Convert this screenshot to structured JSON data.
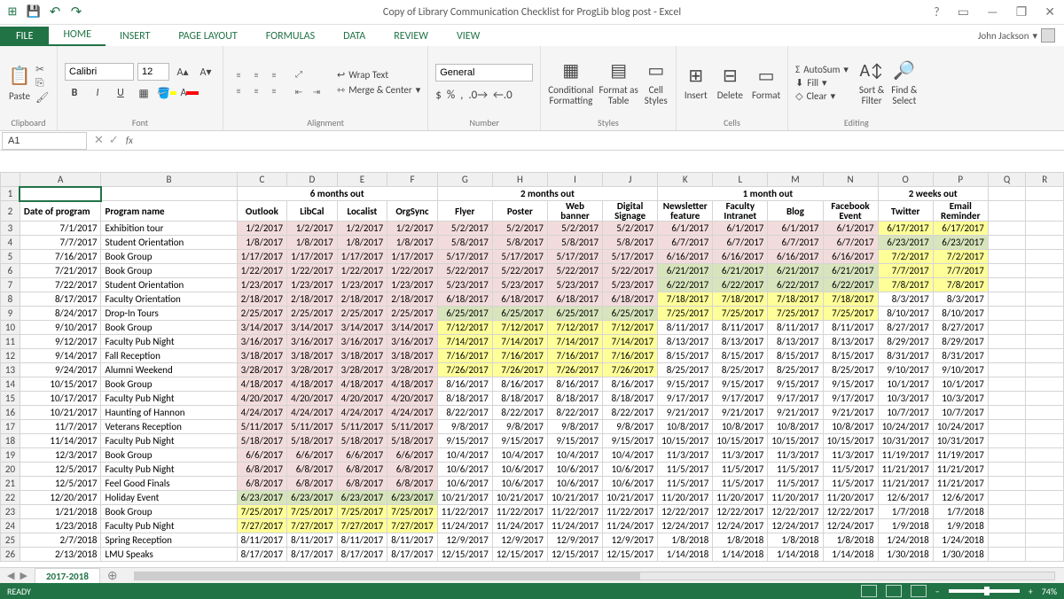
{
  "title": "Copy of Library Communication Checklist for ProgLib blog post - Excel",
  "user": "John Jackson",
  "tabs": {
    "file": "FILE",
    "items": [
      "HOME",
      "INSERT",
      "PAGE LAYOUT",
      "FORMULAS",
      "DATA",
      "REVIEW",
      "VIEW"
    ],
    "active": 0
  },
  "ribbon": {
    "clipboard_label": "Clipboard",
    "paste": "Paste",
    "font_label": "Font",
    "font_name": "Calibri",
    "font_size": "12",
    "alignment_label": "Alignment",
    "wrap": "Wrap Text",
    "merge": "Merge & Center",
    "number_label": "Number",
    "number_fmt": "General",
    "styles_label": "Styles",
    "cond": "Conditional\nFormatting",
    "fat": "Format as\nTable",
    "cell_styles": "Cell\nStyles",
    "cells_label": "Cells",
    "insert": "Insert",
    "delete": "Delete",
    "format": "Format",
    "editing_label": "Editing",
    "autosum": "AutoSum",
    "fill": "Fill",
    "clear": "Clear",
    "sort": "Sort &\nFilter",
    "find": "Find &\nSelect"
  },
  "name_box": "A1",
  "sheet_tab": "2017-2018",
  "status": "READY",
  "zoom": "74%",
  "cols": [
    "A",
    "B",
    "C",
    "D",
    "E",
    "F",
    "G",
    "H",
    "I",
    "J",
    "K",
    "L",
    "M",
    "N",
    "O",
    "P",
    "Q",
    "R"
  ],
  "group_headers": {
    "six_months": "6 months out",
    "two_months": "2 months out",
    "one_month": "1 month out",
    "two_weeks": "2 weeks out"
  },
  "col_headers": {
    "date": "Date of program",
    "name": "Program name",
    "outlook": "Outlook",
    "libcal": "LibCal",
    "localist": "Localist",
    "orgsync": "OrgSync",
    "flyer": "Flyer",
    "poster": "Poster",
    "web": "Web banner",
    "signage": "Digital Signage",
    "news": "Newsletter feature",
    "intranet": "Faculty Intranet",
    "blog": "Blog",
    "fb": "Facebook Event",
    "twitter": "Twitter",
    "email": "Email Reminder"
  },
  "rows": [
    {
      "r": 3,
      "date": "7/1/2017",
      "name": "Exhibition tour",
      "c": [
        "1/2/2017",
        "1/2/2017",
        "1/2/2017",
        "1/2/2017"
      ],
      "d": [
        "5/2/2017",
        "5/2/2017",
        "5/2/2017",
        "5/2/2017"
      ],
      "e": [
        "6/1/2017",
        "6/1/2017",
        "6/1/2017",
        "6/1/2017"
      ],
      "f": [
        "6/17/2017",
        "6/17/2017"
      ],
      "cls": {
        "c": "pink",
        "d": "pink",
        "e": "pink",
        "f": "yellow"
      }
    },
    {
      "r": 4,
      "date": "7/7/2017",
      "name": "Student Orientation",
      "c": [
        "1/8/2017",
        "1/8/2017",
        "1/8/2017",
        "1/8/2017"
      ],
      "d": [
        "5/8/2017",
        "5/8/2017",
        "5/8/2017",
        "5/8/2017"
      ],
      "e": [
        "6/7/2017",
        "6/7/2017",
        "6/7/2017",
        "6/7/2017"
      ],
      "f": [
        "6/23/2017",
        "6/23/2017"
      ],
      "cls": {
        "c": "pink",
        "d": "pink",
        "e": "pink",
        "f": "green"
      }
    },
    {
      "r": 5,
      "date": "7/16/2017",
      "name": "Book Group",
      "c": [
        "1/17/2017",
        "1/17/2017",
        "1/17/2017",
        "1/17/2017"
      ],
      "d": [
        "5/17/2017",
        "5/17/2017",
        "5/17/2017",
        "5/17/2017"
      ],
      "e": [
        "6/16/2017",
        "6/16/2017",
        "6/16/2017",
        "6/16/2017"
      ],
      "f": [
        "7/2/2017",
        "7/2/2017"
      ],
      "cls": {
        "c": "pink",
        "d": "pink",
        "e": "pink",
        "f": "yellow"
      }
    },
    {
      "r": 6,
      "date": "7/21/2017",
      "name": "Book Group",
      "c": [
        "1/22/2017",
        "1/22/2017",
        "1/22/2017",
        "1/22/2017"
      ],
      "d": [
        "5/22/2017",
        "5/22/2017",
        "5/22/2017",
        "5/22/2017"
      ],
      "e": [
        "6/21/2017",
        "6/21/2017",
        "6/21/2017",
        "6/21/2017"
      ],
      "f": [
        "7/7/2017",
        "7/7/2017"
      ],
      "cls": {
        "c": "pink",
        "d": "pink",
        "e": "green",
        "f": "yellow"
      }
    },
    {
      "r": 7,
      "date": "7/22/2017",
      "name": "Student Orientation",
      "c": [
        "1/23/2017",
        "1/23/2017",
        "1/23/2017",
        "1/23/2017"
      ],
      "d": [
        "5/23/2017",
        "5/23/2017",
        "5/23/2017",
        "5/23/2017"
      ],
      "e": [
        "6/22/2017",
        "6/22/2017",
        "6/22/2017",
        "6/22/2017"
      ],
      "f": [
        "7/8/2017",
        "7/8/2017"
      ],
      "cls": {
        "c": "pink",
        "d": "pink",
        "e": "green",
        "f": "yellow"
      }
    },
    {
      "r": 8,
      "date": "8/17/2017",
      "name": "Faculty Orientation",
      "c": [
        "2/18/2017",
        "2/18/2017",
        "2/18/2017",
        "2/18/2017"
      ],
      "d": [
        "6/18/2017",
        "6/18/2017",
        "6/18/2017",
        "6/18/2017"
      ],
      "e": [
        "7/18/2017",
        "7/18/2017",
        "7/18/2017",
        "7/18/2017"
      ],
      "f": [
        "8/3/2017",
        "8/3/2017"
      ],
      "cls": {
        "c": "pink",
        "d": "pink",
        "e": "yellow",
        "f": ""
      }
    },
    {
      "r": 9,
      "date": "8/24/2017",
      "name": "Drop-In Tours",
      "c": [
        "2/25/2017",
        "2/25/2017",
        "2/25/2017",
        "2/25/2017"
      ],
      "d": [
        "6/25/2017",
        "6/25/2017",
        "6/25/2017",
        "6/25/2017"
      ],
      "e": [
        "7/25/2017",
        "7/25/2017",
        "7/25/2017",
        "7/25/2017"
      ],
      "f": [
        "8/10/2017",
        "8/10/2017"
      ],
      "cls": {
        "c": "pink",
        "d": "green",
        "e": "yellow",
        "f": ""
      }
    },
    {
      "r": 10,
      "date": "9/10/2017",
      "name": "Book Group",
      "c": [
        "3/14/2017",
        "3/14/2017",
        "3/14/2017",
        "3/14/2017"
      ],
      "d": [
        "7/12/2017",
        "7/12/2017",
        "7/12/2017",
        "7/12/2017"
      ],
      "e": [
        "8/11/2017",
        "8/11/2017",
        "8/11/2017",
        "8/11/2017"
      ],
      "f": [
        "8/27/2017",
        "8/27/2017"
      ],
      "cls": {
        "c": "pink",
        "d": "yellow",
        "e": "",
        "f": ""
      }
    },
    {
      "r": 11,
      "date": "9/12/2017",
      "name": "Faculty Pub Night",
      "c": [
        "3/16/2017",
        "3/16/2017",
        "3/16/2017",
        "3/16/2017"
      ],
      "d": [
        "7/14/2017",
        "7/14/2017",
        "7/14/2017",
        "7/14/2017"
      ],
      "e": [
        "8/13/2017",
        "8/13/2017",
        "8/13/2017",
        "8/13/2017"
      ],
      "f": [
        "8/29/2017",
        "8/29/2017"
      ],
      "cls": {
        "c": "pink",
        "d": "yellow",
        "e": "",
        "f": ""
      }
    },
    {
      "r": 12,
      "date": "9/14/2017",
      "name": "Fall Reception",
      "c": [
        "3/18/2017",
        "3/18/2017",
        "3/18/2017",
        "3/18/2017"
      ],
      "d": [
        "7/16/2017",
        "7/16/2017",
        "7/16/2017",
        "7/16/2017"
      ],
      "e": [
        "8/15/2017",
        "8/15/2017",
        "8/15/2017",
        "8/15/2017"
      ],
      "f": [
        "8/31/2017",
        "8/31/2017"
      ],
      "cls": {
        "c": "pink",
        "d": "yellow",
        "e": "",
        "f": ""
      }
    },
    {
      "r": 13,
      "date": "9/24/2017",
      "name": "Alumni Weekend",
      "c": [
        "3/28/2017",
        "3/28/2017",
        "3/28/2017",
        "3/28/2017"
      ],
      "d": [
        "7/26/2017",
        "7/26/2017",
        "7/26/2017",
        "7/26/2017"
      ],
      "e": [
        "8/25/2017",
        "8/25/2017",
        "8/25/2017",
        "8/25/2017"
      ],
      "f": [
        "9/10/2017",
        "9/10/2017"
      ],
      "cls": {
        "c": "pink",
        "d": "yellow",
        "e": "",
        "f": ""
      }
    },
    {
      "r": 14,
      "date": "10/15/2017",
      "name": "Book Group",
      "c": [
        "4/18/2017",
        "4/18/2017",
        "4/18/2017",
        "4/18/2017"
      ],
      "d": [
        "8/16/2017",
        "8/16/2017",
        "8/16/2017",
        "8/16/2017"
      ],
      "e": [
        "9/15/2017",
        "9/15/2017",
        "9/15/2017",
        "9/15/2017"
      ],
      "f": [
        "10/1/2017",
        "10/1/2017"
      ],
      "cls": {
        "c": "pink",
        "d": "",
        "e": "",
        "f": ""
      }
    },
    {
      "r": 15,
      "date": "10/17/2017",
      "name": "Faculty Pub Night",
      "c": [
        "4/20/2017",
        "4/20/2017",
        "4/20/2017",
        "4/20/2017"
      ],
      "d": [
        "8/18/2017",
        "8/18/2017",
        "8/18/2017",
        "8/18/2017"
      ],
      "e": [
        "9/17/2017",
        "9/17/2017",
        "9/17/2017",
        "9/17/2017"
      ],
      "f": [
        "10/3/2017",
        "10/3/2017"
      ],
      "cls": {
        "c": "pink",
        "d": "",
        "e": "",
        "f": ""
      }
    },
    {
      "r": 16,
      "date": "10/21/2017",
      "name": "Haunting of Hannon",
      "c": [
        "4/24/2017",
        "4/24/2017",
        "4/24/2017",
        "4/24/2017"
      ],
      "d": [
        "8/22/2017",
        "8/22/2017",
        "8/22/2017",
        "8/22/2017"
      ],
      "e": [
        "9/21/2017",
        "9/21/2017",
        "9/21/2017",
        "9/21/2017"
      ],
      "f": [
        "10/7/2017",
        "10/7/2017"
      ],
      "cls": {
        "c": "pink",
        "d": "",
        "e": "",
        "f": ""
      }
    },
    {
      "r": 17,
      "date": "11/7/2017",
      "name": "Veterans Reception",
      "c": [
        "5/11/2017",
        "5/11/2017",
        "5/11/2017",
        "5/11/2017"
      ],
      "d": [
        "9/8/2017",
        "9/8/2017",
        "9/8/2017",
        "9/8/2017"
      ],
      "e": [
        "10/8/2017",
        "10/8/2017",
        "10/8/2017",
        "10/8/2017"
      ],
      "f": [
        "10/24/2017",
        "10/24/2017"
      ],
      "cls": {
        "c": "pink",
        "d": "",
        "e": "",
        "f": ""
      }
    },
    {
      "r": 18,
      "date": "11/14/2017",
      "name": "Faculty Pub Night",
      "c": [
        "5/18/2017",
        "5/18/2017",
        "5/18/2017",
        "5/18/2017"
      ],
      "d": [
        "9/15/2017",
        "9/15/2017",
        "9/15/2017",
        "9/15/2017"
      ],
      "e": [
        "10/15/2017",
        "10/15/2017",
        "10/15/2017",
        "10/15/2017"
      ],
      "f": [
        "10/31/2017",
        "10/31/2017"
      ],
      "cls": {
        "c": "pink",
        "d": "",
        "e": "",
        "f": ""
      }
    },
    {
      "r": 19,
      "date": "12/3/2017",
      "name": "Book Group",
      "c": [
        "6/6/2017",
        "6/6/2017",
        "6/6/2017",
        "6/6/2017"
      ],
      "d": [
        "10/4/2017",
        "10/4/2017",
        "10/4/2017",
        "10/4/2017"
      ],
      "e": [
        "11/3/2017",
        "11/3/2017",
        "11/3/2017",
        "11/3/2017"
      ],
      "f": [
        "11/19/2017",
        "11/19/2017"
      ],
      "cls": {
        "c": "pink",
        "d": "",
        "e": "",
        "f": ""
      }
    },
    {
      "r": 20,
      "date": "12/5/2017",
      "name": "Faculty Pub Night",
      "c": [
        "6/8/2017",
        "6/8/2017",
        "6/8/2017",
        "6/8/2017"
      ],
      "d": [
        "10/6/2017",
        "10/6/2017",
        "10/6/2017",
        "10/6/2017"
      ],
      "e": [
        "11/5/2017",
        "11/5/2017",
        "11/5/2017",
        "11/5/2017"
      ],
      "f": [
        "11/21/2017",
        "11/21/2017"
      ],
      "cls": {
        "c": "pink",
        "d": "",
        "e": "",
        "f": ""
      }
    },
    {
      "r": 21,
      "date": "12/5/2017",
      "name": "Feel Good Finals",
      "c": [
        "6/8/2017",
        "6/8/2017",
        "6/8/2017",
        "6/8/2017"
      ],
      "d": [
        "10/6/2017",
        "10/6/2017",
        "10/6/2017",
        "10/6/2017"
      ],
      "e": [
        "11/5/2017",
        "11/5/2017",
        "11/5/2017",
        "11/5/2017"
      ],
      "f": [
        "11/21/2017",
        "11/21/2017"
      ],
      "cls": {
        "c": "pink",
        "d": "",
        "e": "",
        "f": ""
      }
    },
    {
      "r": 22,
      "date": "12/20/2017",
      "name": "Holiday Event",
      "c": [
        "6/23/2017",
        "6/23/2017",
        "6/23/2017",
        "6/23/2017"
      ],
      "d": [
        "10/21/2017",
        "10/21/2017",
        "10/21/2017",
        "10/21/2017"
      ],
      "e": [
        "11/20/2017",
        "11/20/2017",
        "11/20/2017",
        "11/20/2017"
      ],
      "f": [
        "12/6/2017",
        "12/6/2017"
      ],
      "cls": {
        "c": "green",
        "d": "",
        "e": "",
        "f": ""
      }
    },
    {
      "r": 23,
      "date": "1/21/2018",
      "name": "Book Group",
      "c": [
        "7/25/2017",
        "7/25/2017",
        "7/25/2017",
        "7/25/2017"
      ],
      "d": [
        "11/22/2017",
        "11/22/2017",
        "11/22/2017",
        "11/22/2017"
      ],
      "e": [
        "12/22/2017",
        "12/22/2017",
        "12/22/2017",
        "12/22/2017"
      ],
      "f": [
        "1/7/2018",
        "1/7/2018"
      ],
      "cls": {
        "c": "yellow",
        "d": "",
        "e": "",
        "f": ""
      }
    },
    {
      "r": 24,
      "date": "1/23/2018",
      "name": "Faculty Pub Night",
      "c": [
        "7/27/2017",
        "7/27/2017",
        "7/27/2017",
        "7/27/2017"
      ],
      "d": [
        "11/24/2017",
        "11/24/2017",
        "11/24/2017",
        "11/24/2017"
      ],
      "e": [
        "12/24/2017",
        "12/24/2017",
        "12/24/2017",
        "12/24/2017"
      ],
      "f": [
        "1/9/2018",
        "1/9/2018"
      ],
      "cls": {
        "c": "yellow",
        "d": "",
        "e": "",
        "f": ""
      }
    },
    {
      "r": 25,
      "date": "2/7/2018",
      "name": "Spring Reception",
      "c": [
        "8/11/2017",
        "8/11/2017",
        "8/11/2017",
        "8/11/2017"
      ],
      "d": [
        "12/9/2017",
        "12/9/2017",
        "12/9/2017",
        "12/9/2017"
      ],
      "e": [
        "1/8/2018",
        "1/8/2018",
        "1/8/2018",
        "1/8/2018"
      ],
      "f": [
        "1/24/2018",
        "1/24/2018"
      ],
      "cls": {
        "c": "",
        "d": "",
        "e": "",
        "f": ""
      }
    },
    {
      "r": 26,
      "date": "2/13/2018",
      "name": "LMU Speaks",
      "c": [
        "8/17/2017",
        "8/17/2017",
        "8/17/2017",
        "8/17/2017"
      ],
      "d": [
        "12/15/2017",
        "12/15/2017",
        "12/15/2017",
        "12/15/2017"
      ],
      "e": [
        "1/14/2018",
        "1/14/2018",
        "1/14/2018",
        "1/14/2018"
      ],
      "f": [
        "1/30/2018",
        "1/30/2018"
      ],
      "cls": {
        "c": "",
        "d": "",
        "e": "",
        "f": ""
      }
    }
  ]
}
